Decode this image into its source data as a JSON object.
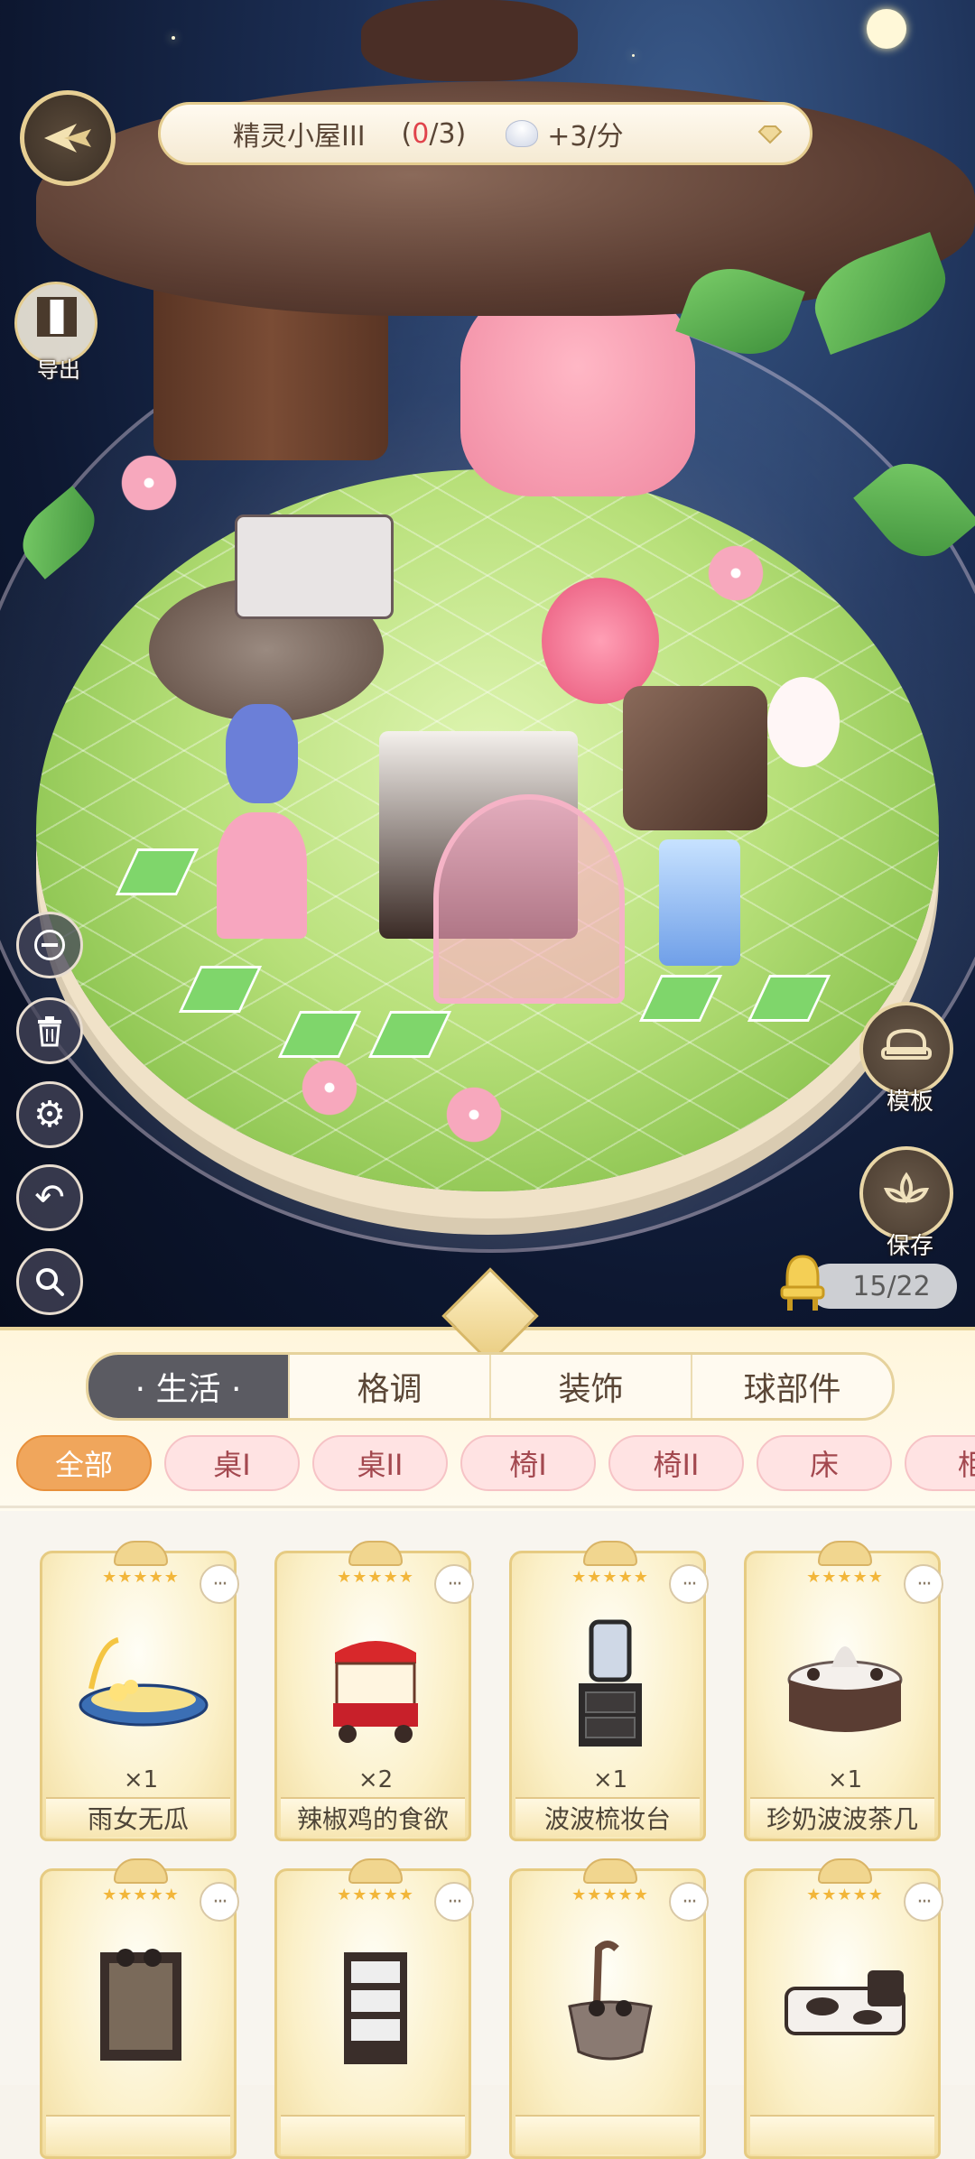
{
  "header": {
    "room_name": "精灵小屋III",
    "count_open": "(",
    "count_current": "0",
    "count_total": "/3)",
    "rate": "+3/分"
  },
  "left_tools": {
    "export_label": "导出"
  },
  "right_tools": {
    "template_label": "模板",
    "save_label": "保存"
  },
  "capacity": "15/22",
  "main_tabs": [
    "· 生活 ·",
    "格调",
    "装饰",
    "球部件"
  ],
  "sub_tabs": [
    "全部",
    "桌I",
    "桌II",
    "椅I",
    "椅II",
    "床",
    "柜"
  ],
  "items": [
    {
      "name": "雨女无瓜",
      "qty": "×1",
      "stars": "★★★★★"
    },
    {
      "name": "辣椒鸡的食欲",
      "qty": "×2",
      "stars": "★★★★★"
    },
    {
      "name": "波波梳妆台",
      "qty": "×1",
      "stars": "★★★★★"
    },
    {
      "name": "珍奶波波茶几",
      "qty": "×1",
      "stars": "★★★★★"
    },
    {
      "name": "",
      "qty": "",
      "stars": "★★★★★"
    },
    {
      "name": "",
      "qty": "",
      "stars": "★★★★★"
    },
    {
      "name": "",
      "qty": "",
      "stars": "★★★★★"
    },
    {
      "name": "",
      "qty": "",
      "stars": "★★★★★"
    }
  ],
  "colors": {
    "accent_gold": "#e4cc8e",
    "active_tab": "#5b5b62",
    "active_chip": "#f0a65c",
    "chip_pink": "#ffe3e3"
  }
}
